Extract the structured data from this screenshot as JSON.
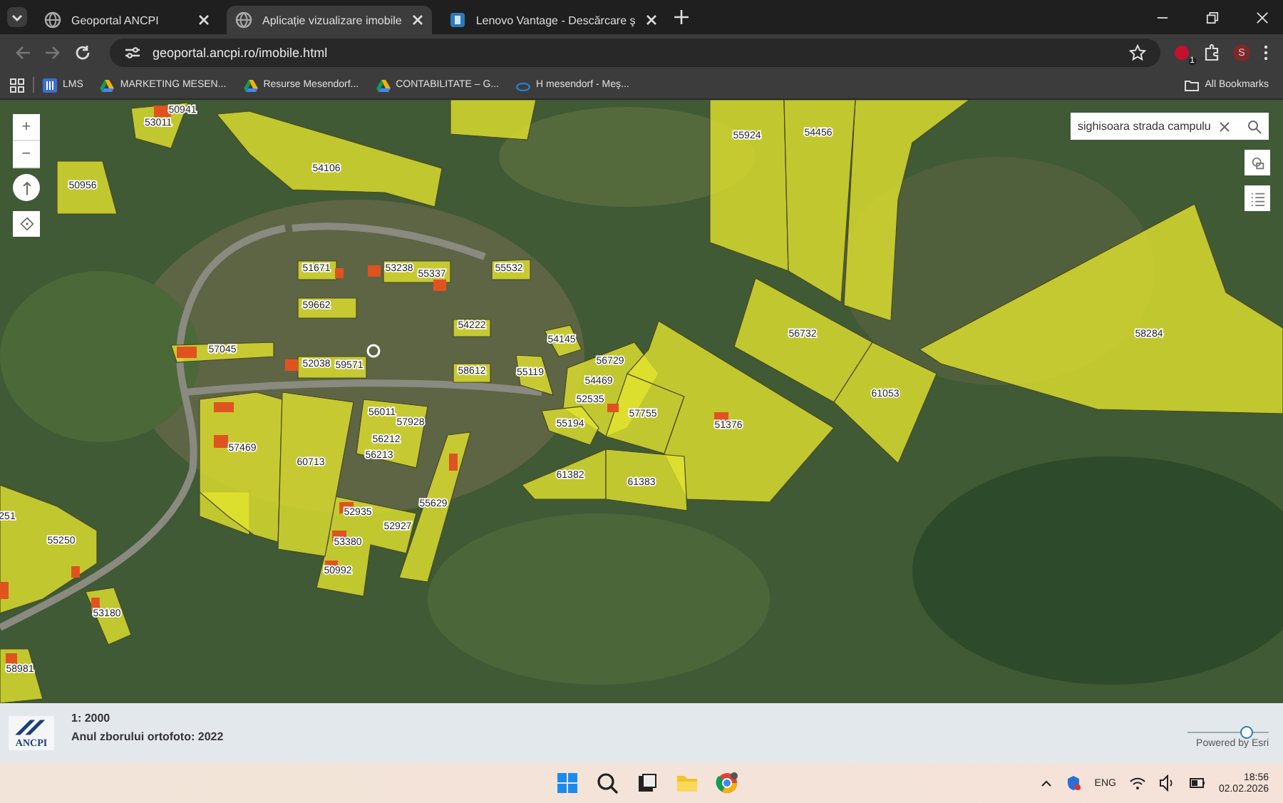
{
  "browser": {
    "tabs": [
      {
        "title": "Geoportal ANCPI",
        "selected": false,
        "kind": "globe"
      },
      {
        "title": "Aplicație vizualizare imobile",
        "selected": true,
        "kind": "globe"
      },
      {
        "title": "Lenovo Vantage - Descărcare ş",
        "selected": false,
        "kind": "app"
      }
    ],
    "url": "geoportal.ancpi.ro/imobile.html",
    "extension_badge": "1",
    "profile_initial": "S",
    "bookmarks": [
      {
        "label": "LMS",
        "kind": "lms"
      },
      {
        "label": "MARKETING MESEN...",
        "kind": "drive"
      },
      {
        "label": "Resurse Mesendorf...",
        "kind": "drive"
      },
      {
        "label": "CONTABILITATE – G...",
        "kind": "drive"
      },
      {
        "label": "H mesendorf - Meş...",
        "kind": "cloud"
      }
    ],
    "all_bookmarks": "All Bookmarks"
  },
  "map": {
    "zoom_in": "+",
    "zoom_out": "−",
    "search": {
      "value": "sighisoara strada campulu"
    },
    "parcels": [
      {
        "label": "50941"
      },
      {
        "label": "53011"
      },
      {
        "label": "54106"
      },
      {
        "label": "50956"
      },
      {
        "label": "51671"
      },
      {
        "label": "53238"
      },
      {
        "label": "55337"
      },
      {
        "label": "55532"
      },
      {
        "label": "59662"
      },
      {
        "label": "54222"
      },
      {
        "label": "54145"
      },
      {
        "label": "56729"
      },
      {
        "label": "57045"
      },
      {
        "label": "52038"
      },
      {
        "label": "59571"
      },
      {
        "label": "58612"
      },
      {
        "label": "55119"
      },
      {
        "label": "54469"
      },
      {
        "label": "52535"
      },
      {
        "label": "56011"
      },
      {
        "label": "57928"
      },
      {
        "label": "57755"
      },
      {
        "label": "55194"
      },
      {
        "label": "51376"
      },
      {
        "label": "57469"
      },
      {
        "label": "60713"
      },
      {
        "label": "56212"
      },
      {
        "label": "56213"
      },
      {
        "label": "61382"
      },
      {
        "label": "61383"
      },
      {
        "label": "55629"
      },
      {
        "label": "52935"
      },
      {
        "label": "52927"
      },
      {
        "label": "53380"
      },
      {
        "label": "50992"
      },
      {
        "label": "251"
      },
      {
        "label": "55250"
      },
      {
        "label": "53180"
      },
      {
        "label": "58981"
      },
      {
        "label": "55924"
      },
      {
        "label": "54456"
      },
      {
        "label": "56732"
      },
      {
        "label": "61053"
      },
      {
        "label": "58284"
      }
    ]
  },
  "info_bar": {
    "logo_text": "ANCPI",
    "scale": "1: 2000",
    "ortho_year": "Anul zborului ortofoto: 2022",
    "zoom_slider": {
      "level": 0.72
    },
    "powered_by": "Powered by Esri"
  },
  "taskbar": {
    "language": "ENG",
    "time": "18:56",
    "date": "02.02.2026"
  }
}
